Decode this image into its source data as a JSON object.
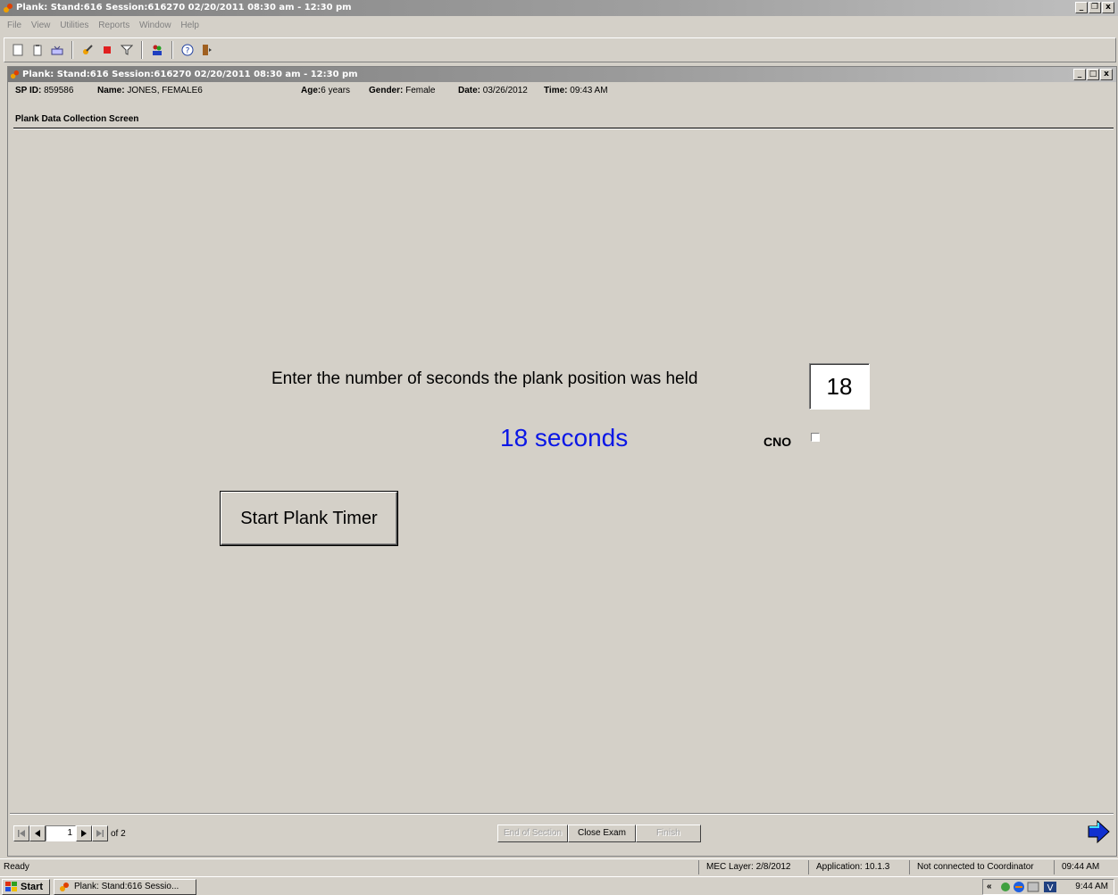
{
  "app": {
    "title": "Plank: Stand:616 Session:616270 02/20/2011 08:30 am - 12:30 pm",
    "window_buttons": [
      "_",
      "&#x2752;",
      "x"
    ]
  },
  "menu": [
    "File",
    "View",
    "Utilities",
    "Reports",
    "Window",
    "Help"
  ],
  "doc": {
    "title": "Plank: Stand:616 Session:616270 02/20/2011 08:30 am - 12:30 pm",
    "participant": {
      "sp_id_label": "SP ID:",
      "sp_id": "859586",
      "name_label": "Name:",
      "name": "JONES, FEMALE6",
      "age_label": "Age:",
      "age": "6 years",
      "gender_label": "Gender:",
      "gender": "Female",
      "date_label": "Date:",
      "date": "03/26/2012",
      "time_label": "Time:",
      "time": "09:43 AM"
    },
    "screen_title": "Plank Data Collection Screen"
  },
  "form": {
    "prompt": "Enter the number of seconds the plank position was held",
    "seconds_value": "18",
    "seconds_display": "18 seconds",
    "cno_label": "CNO",
    "cno_checked": false,
    "start_timer_label": "Start Plank Timer"
  },
  "pager": {
    "page": "1",
    "of_text": "of 2"
  },
  "buttons": {
    "end_of_section": "End of Section",
    "close_exam": "Close Exam",
    "finish": "Finish"
  },
  "status": {
    "ready": "Ready",
    "mec_layer": "MEC Layer: 2/8/2012",
    "application": "Application: 10.1.3",
    "coordinator": "Not connected to Coordinator",
    "time": "09:44 AM"
  },
  "taskbar": {
    "start": "Start",
    "task": "Plank: Stand:616 Sessio...",
    "tray_chevron": "«",
    "clock": "9:44 AM"
  },
  "colors": {
    "seconds_display": "#0b17e6"
  }
}
